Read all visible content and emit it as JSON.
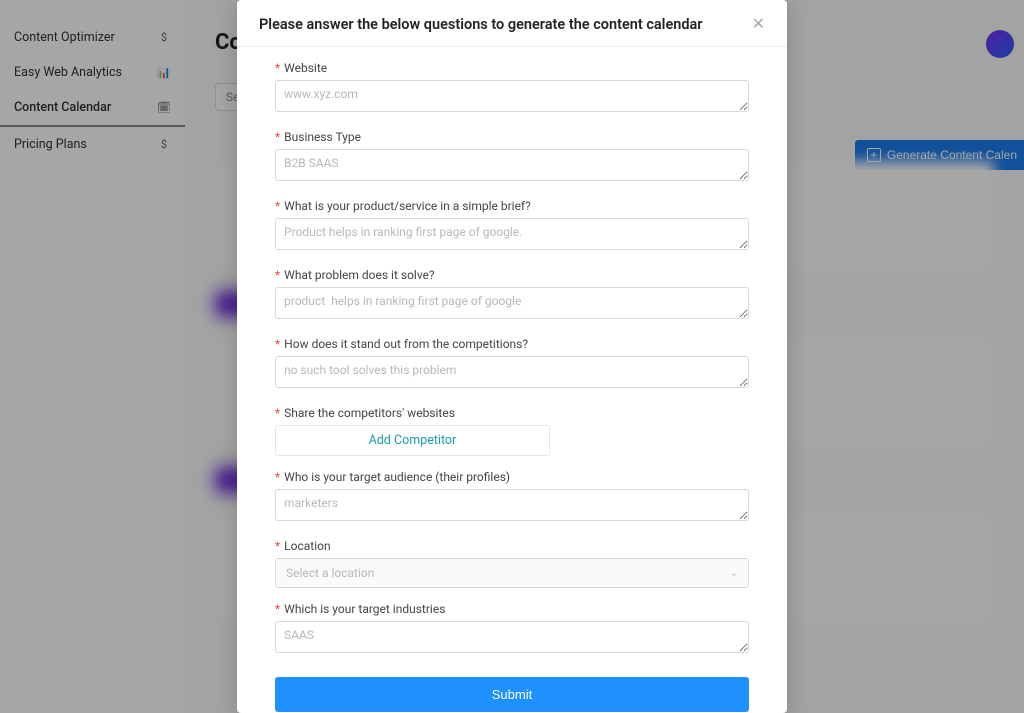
{
  "sidebar": {
    "items": [
      {
        "label": "Content Optimizer",
        "icon": "$"
      },
      {
        "label": "Easy Web Analytics",
        "icon": "📊"
      },
      {
        "label": "Content Calendar",
        "icon": "🗓"
      },
      {
        "label": "Pricing Plans",
        "icon": "$"
      }
    ]
  },
  "page": {
    "title": "Content Calendar",
    "select_placeholder": "Sele",
    "generate_label": "Generate Content Calen"
  },
  "modal": {
    "title": "Please answer the below questions to generate the content calendar",
    "fields": {
      "website": {
        "label": "Website",
        "placeholder": "www.xyz.com"
      },
      "business_type": {
        "label": "Business Type",
        "placeholder": "B2B SAAS"
      },
      "product_brief": {
        "label": "What is your product/service in a simple brief?",
        "placeholder": "Product helps in ranking first page of google."
      },
      "problem": {
        "label": "What problem does it solve?",
        "placeholder": "product  helps in ranking first page of google"
      },
      "standout": {
        "label": "How does it stand out from the competitions?",
        "placeholder": "no such tool solves this problem"
      },
      "competitors": {
        "label": "Share the competitors' websites",
        "add_label": "Add Competitor"
      },
      "audience": {
        "label": "Who is your target audience (their profiles)",
        "placeholder": "marketers"
      },
      "location": {
        "label": "Location",
        "placeholder": "Select a location"
      },
      "industries": {
        "label": "Which is your target industries",
        "placeholder": "SAAS"
      }
    },
    "submit_label": "Submit"
  }
}
